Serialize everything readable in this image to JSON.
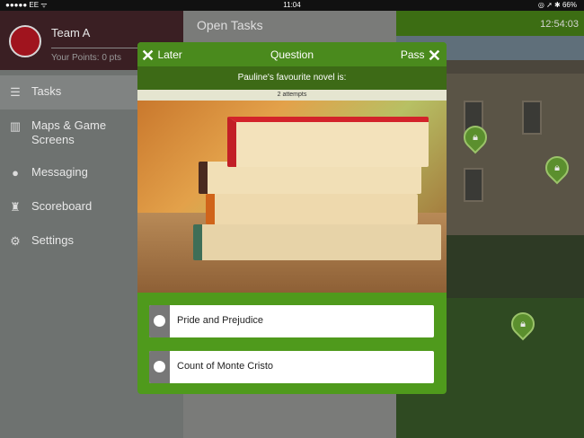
{
  "status_bar": {
    "carrier": "●●●●● EE ᯤ",
    "time": "11:04",
    "battery": "◎ ➚ ✱ 66%"
  },
  "sidebar": {
    "team_name": "Team A",
    "points": "Your Points: 0 pts",
    "items": [
      {
        "label": "Tasks",
        "icon": "list-icon"
      },
      {
        "label": "Maps & Game Screens",
        "icon": "map-icon"
      },
      {
        "label": "Messaging",
        "icon": "chat-bubble-icon"
      },
      {
        "label": "Scoreboard",
        "icon": "trophy-icon"
      },
      {
        "label": "Settings",
        "icon": "gear-icon"
      }
    ]
  },
  "content": {
    "title": "Open Tasks"
  },
  "map": {
    "timer": "12:54:03",
    "pin_icon": "lock-icon"
  },
  "dialog": {
    "later_label": "Later",
    "title": "Question",
    "pass_label": "Pass",
    "question": "Pauline's favourite novel is:",
    "attempts": "2 attempts",
    "options": [
      {
        "label": "Pride and Prejudice"
      },
      {
        "label": "Count of Monte Cristo"
      }
    ]
  },
  "colors": {
    "accent_green": "#4f9a1c",
    "header_green": "#3c6d13",
    "avatar_red": "#a0141e"
  }
}
